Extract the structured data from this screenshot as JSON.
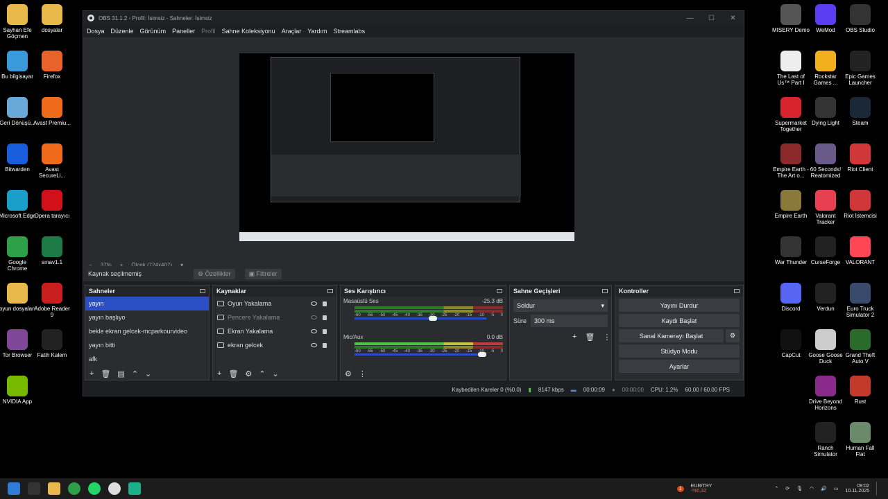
{
  "desktop_left": [
    {
      "label": "Sayhan Efe Göçmen",
      "color": "#e8b84a"
    },
    {
      "label": "dosyalar",
      "color": "#e8b84a"
    },
    {
      "label": "Bu bilgisayar",
      "color": "#3a9ad9"
    },
    {
      "label": "Firefox",
      "color": "#e8622c"
    },
    {
      "label": "Geri Dönüşü...",
      "color": "#6aa8d8"
    },
    {
      "label": "Avast Premiu...",
      "color": "#f06a1c"
    },
    {
      "label": "Bitwarden",
      "color": "#175ddc"
    },
    {
      "label": "Avast SecureLi...",
      "color": "#f06a1c"
    },
    {
      "label": "Microsoft Edge",
      "color": "#1aa0c8"
    },
    {
      "label": "Opera tarayıcı",
      "color": "#d1101a"
    },
    {
      "label": "Google Chrome",
      "color": "#2fa04a"
    },
    {
      "label": "sınav1.1",
      "color": "#1e7b45"
    },
    {
      "label": "oyun dosyaları",
      "color": "#e8b84a"
    },
    {
      "label": "Adobe Reader 9",
      "color": "#c81e1e"
    },
    {
      "label": "Tor Browser",
      "color": "#7e4798"
    },
    {
      "label": "Fatih Kalem",
      "color": "#222222"
    },
    {
      "label": "NVIDIA App",
      "color": "#76b900"
    }
  ],
  "desktop_right": [
    {
      "label": "MISERY Demo",
      "color": "#555555"
    },
    {
      "label": "WeMod",
      "color": "#5a3df0"
    },
    {
      "label": "OBS Studio",
      "color": "#333333"
    },
    {
      "label": "The Last of Us™ Part I",
      "color": "#eeeeee"
    },
    {
      "label": "Rockstar Games ...",
      "color": "#f2b01e"
    },
    {
      "label": "Epic Games Launcher",
      "color": "#222222"
    },
    {
      "label": "Supermarket Together",
      "color": "#d8242c"
    },
    {
      "label": "Dying Light",
      "color": "#333333"
    },
    {
      "label": "Steam",
      "color": "#1b2838"
    },
    {
      "label": "Empire Earth - The Art o...",
      "color": "#8a2a2a"
    },
    {
      "label": "60 Seconds! Reatomized",
      "color": "#6a5a8a"
    },
    {
      "label": "Riot Client",
      "color": "#d13639"
    },
    {
      "label": "Empire Earth",
      "color": "#8a7a3a"
    },
    {
      "label": "Valorant Tracker",
      "color": "#e84050"
    },
    {
      "label": "Riot İstemcisi",
      "color": "#d13639"
    },
    {
      "label": "War Thunder",
      "color": "#333333"
    },
    {
      "label": "CurseForge",
      "color": "#222222"
    },
    {
      "label": "VALORANT",
      "color": "#ff4655"
    },
    {
      "label": "Discord",
      "color": "#5865f2"
    },
    {
      "label": "Verdun",
      "color": "#222222"
    },
    {
      "label": "Euro Truck Simulator 2",
      "color": "#3a4a6a"
    },
    {
      "label": "CapCut",
      "color": "#111111"
    },
    {
      "label": "Goose Goose Duck",
      "color": "#cccccc"
    },
    {
      "label": "Grand Theft Auto V",
      "color": "#2a6a2a"
    },
    {
      "label": "Drive Beyond Horizons",
      "color": "#8a2a8a"
    },
    {
      "label": "Rust",
      "color": "#c33a2a"
    },
    {
      "label": "Ranch Simulator",
      "color": "#222222"
    },
    {
      "label": "Human Fall Flat",
      "color": "#6a8a6a"
    }
  ],
  "window": {
    "title": "OBS 31.1.2 - Profil: İsimsiz - Sahneler: İsimsiz",
    "controls": [
      "—",
      "☐",
      "✕"
    ]
  },
  "menu": [
    "Dosya",
    "Düzenle",
    "Görünüm",
    "Paneller",
    "Profil",
    "Sahne Koleksiyonu",
    "Araçlar",
    "Yardım",
    "Streamlabs"
  ],
  "zoom": {
    "minus": "−",
    "value": "37%",
    "plus": "+",
    "scale": "Ölçek (724x407)"
  },
  "source_bar": {
    "none": "Kaynak seçilmemiş",
    "props": "Özellikler",
    "filters": "Filtreler"
  },
  "scenes": {
    "title": "Sahneler",
    "items": [
      "yayın",
      "yayın başlıyo",
      "bekle ekran gelcek-mcparkourvideo",
      "yayın bitti",
      "afk"
    ],
    "selected": 0
  },
  "sources": {
    "title": "Kaynaklar",
    "items": [
      {
        "label": "Oyun Yakalama",
        "visible": true
      },
      {
        "label": "Pencere Yakalama",
        "visible": false
      },
      {
        "label": "Ekran Yakalama",
        "visible": true
      },
      {
        "label": "ekran gelcek",
        "visible": true
      }
    ]
  },
  "mixer": {
    "title": "Ses Karıştırıcı",
    "channels": [
      {
        "name": "Masaüstü Ses",
        "db": "-25.3 dB",
        "volume": 0.6
      },
      {
        "name": "Mic/Aux",
        "db": "0.0 dB",
        "volume": 1.0
      }
    ],
    "ticks": [
      "-60",
      "-55",
      "-50",
      "-45",
      "-40",
      "-35",
      "-30",
      "-25",
      "-20",
      "-15",
      "-10",
      "-5",
      "0"
    ]
  },
  "transitions": {
    "title": "Sahne Geçişleri",
    "selected": "Soldur",
    "duration_label": "Süre",
    "duration": "300 ms"
  },
  "controls": {
    "title": "Kontroller",
    "buttons": [
      "Yayını Durdur",
      "Kaydı Başlat",
      "Sanal Kamerayı Başlat",
      "Stüdyo Modu",
      "Ayarlar"
    ]
  },
  "status": {
    "dropped": "Kaybedilen Kareler 0 (%0.0)",
    "bitrate": "8147 kbps",
    "stream_time": "00:00:09",
    "rec_time": "00:00:00",
    "cpu": "CPU: 1.2%",
    "fps": "60.00 / 60.00 FPS"
  },
  "taskbar": {
    "currency": "EUR/TRY",
    "currency_change": "-%0,32",
    "badge": "1",
    "time": "09:02",
    "date": "10.11.2025"
  }
}
